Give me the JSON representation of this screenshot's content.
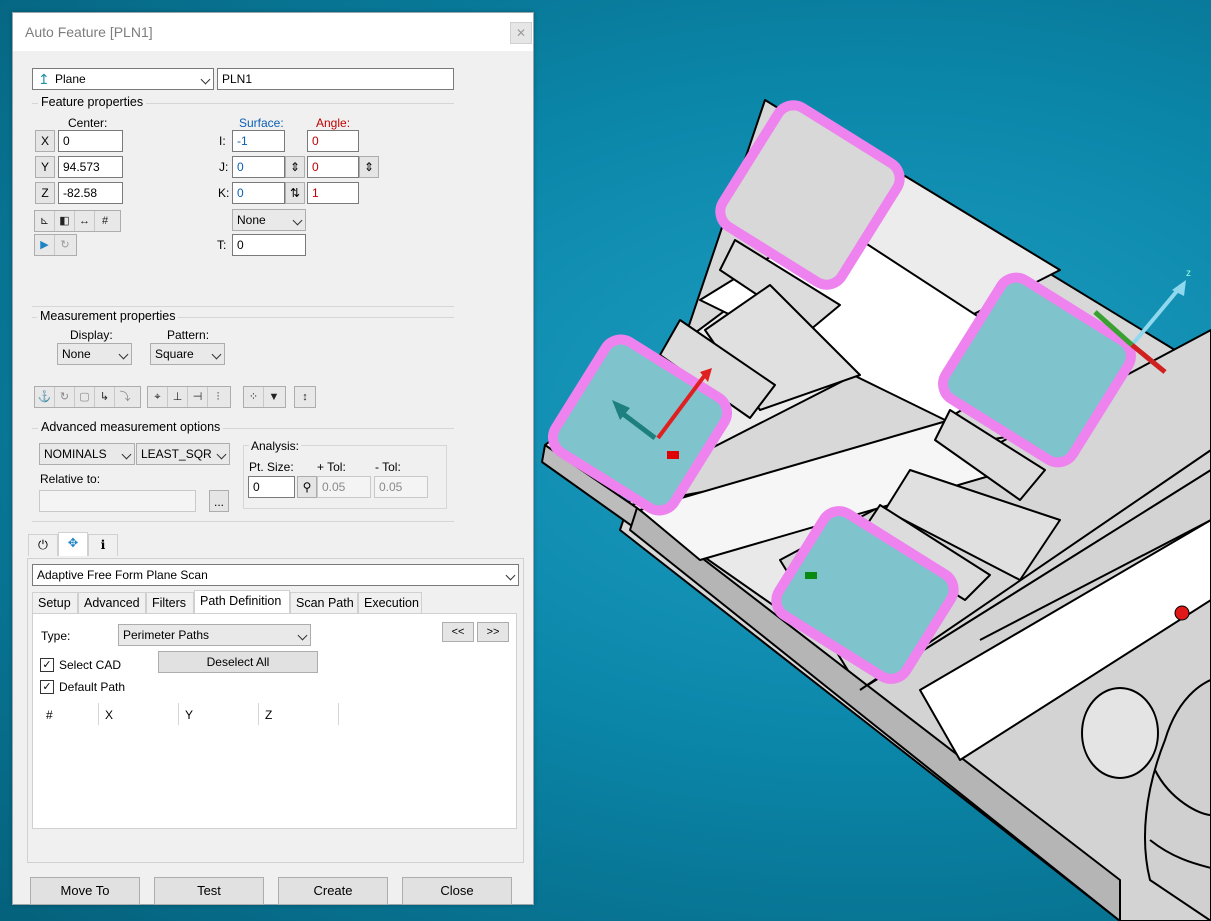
{
  "dialog": {
    "title": "Auto Feature [PLN1]",
    "close_glyph": "✕",
    "feature_type": "Plane",
    "feature_id": "PLN1"
  },
  "feature_properties": {
    "title": "Feature properties",
    "center_label": "Center:",
    "x_label": "X",
    "x_value": "0",
    "y_label": "Y",
    "y_value": "94.573",
    "z_label": "Z",
    "z_value": "-82.58",
    "surface_label": "Surface:",
    "angle_label": "Angle:",
    "i_label": "I:",
    "j_label": "J:",
    "k_label": "K:",
    "t_label": "T:",
    "surface_i": "-1",
    "surface_j": "0",
    "surface_k": "0",
    "angle_i": "0",
    "angle_j": "0",
    "angle_k": "1",
    "vector_combo": "None",
    "thickness": "0",
    "colors": {
      "surface": "#0a5fb4",
      "angle": "#c00000"
    }
  },
  "measurement_properties": {
    "title": "Measurement properties",
    "display_label": "Display:",
    "display_value": "None",
    "pattern_label": "Pattern:",
    "pattern_value": "Square"
  },
  "advanced": {
    "title": "Advanced measurement options",
    "nominals": "NOMINALS",
    "fit": "LEAST_SQR",
    "relative_to_label": "Relative to:",
    "relative_to_value": "",
    "browse_label": "...",
    "analysis_label": "Analysis:",
    "pt_size_label": "Pt. Size:",
    "pt_size_value": "0",
    "plus_tol_label": "+ Tol:",
    "plus_tol_value": "0.05",
    "minus_tol_label": "- Tol:",
    "minus_tol_value": "0.05"
  },
  "scan": {
    "method": "Adaptive Free Form Plane Scan",
    "tabs": [
      "Setup",
      "Advanced",
      "Filters",
      "Path Definition",
      "Scan Path",
      "Execution"
    ],
    "active_tab": "Path Definition",
    "type_label": "Type:",
    "type_value": "Perimeter Paths",
    "prev_label": "<<",
    "next_label": ">>",
    "deselect_all": "Deselect All",
    "select_cad_label": "Select CAD",
    "select_cad_checked": true,
    "default_path_label": "Default Path",
    "default_path_checked": true,
    "columns": [
      "#",
      "X",
      "Y",
      "Z"
    ]
  },
  "buttons": {
    "move_to": "Move To",
    "test": "Test",
    "create": "Create",
    "close": "Close"
  }
}
